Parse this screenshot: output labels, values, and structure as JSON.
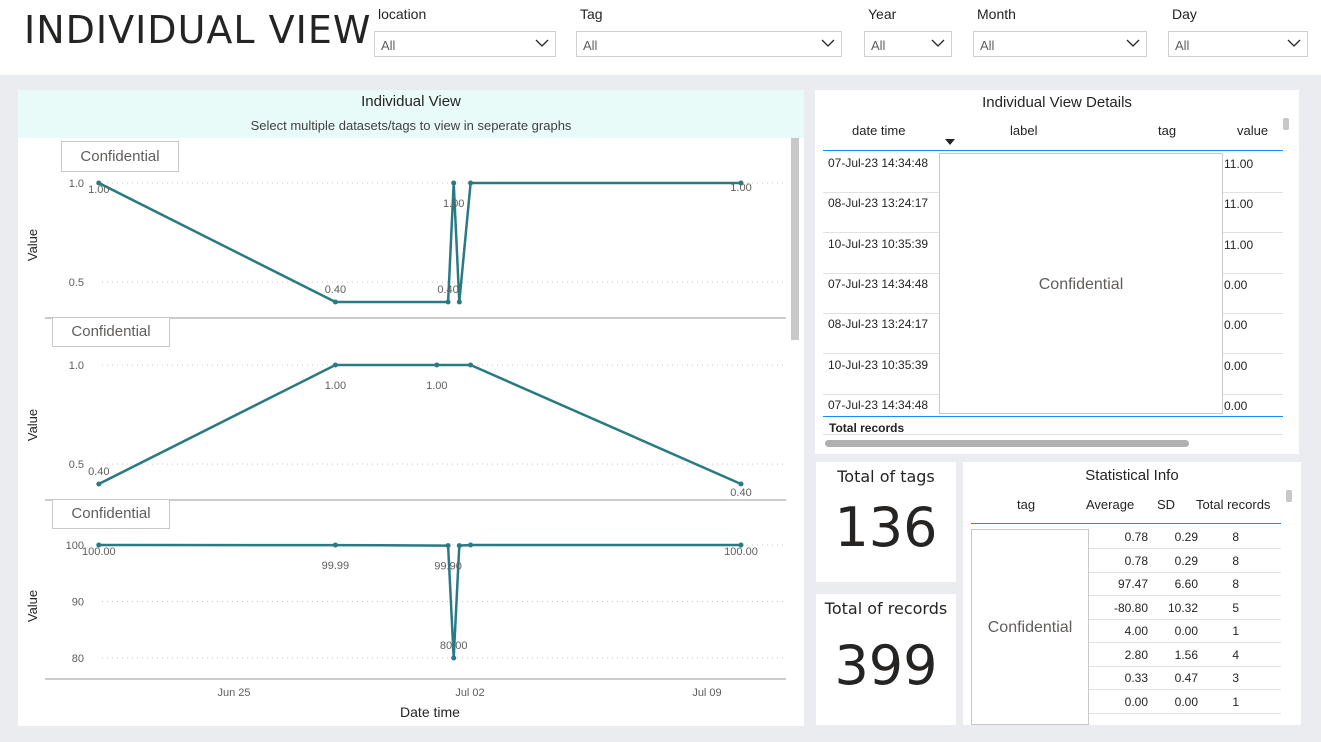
{
  "page_title": "INDIVIDUAL VIEW",
  "filters": [
    {
      "label": "location",
      "value": "All"
    },
    {
      "label": "Tag",
      "value": "All"
    },
    {
      "label": "Year",
      "value": "All"
    },
    {
      "label": "Month",
      "value": "All"
    },
    {
      "label": "Day",
      "value": "All"
    }
  ],
  "individual_view": {
    "title": "Individual View",
    "subtitle": "Select multiple datasets/tags to view in seperate graphs",
    "y_axis_label": "Value",
    "x_axis_label": "Date time",
    "x_ticks": [
      "Jun 25",
      "Jul 02",
      "Jul 09"
    ]
  },
  "chart_data": [
    {
      "type": "line",
      "title": "Confidential",
      "ylabel": "Value",
      "xlabel": "Date time",
      "y_ticks": [
        "1.0",
        "0.5"
      ],
      "ylim": [
        0.4,
        1.0
      ],
      "x_ticks": [
        "Jun 25",
        "Jul 02",
        "Jul 09"
      ],
      "series": [
        {
          "x": [
            "2023-06-21",
            "2023-06-28",
            "2023-07-01 08:00",
            "2023-07-01 12:00",
            "2023-07-01 16:00",
            "2023-07-02",
            "2023-07-10"
          ],
          "values": [
            1.0,
            0.4,
            0.4,
            1.0,
            0.4,
            1.0,
            1.0
          ]
        }
      ],
      "data_labels": [
        "1.00",
        "0.40",
        "0.40",
        "1.00",
        "1.00"
      ]
    },
    {
      "type": "line",
      "title": "Confidential",
      "ylabel": "Value",
      "y_ticks": [
        "1.0",
        "0.5"
      ],
      "ylim": [
        0.4,
        1.0
      ],
      "series": [
        {
          "x": [
            "2023-06-21",
            "2023-06-28",
            "2023-07-01",
            "2023-07-02",
            "2023-07-10"
          ],
          "values": [
            0.4,
            1.0,
            1.0,
            1.0,
            0.4
          ]
        }
      ],
      "data_labels": [
        "0.40",
        "1.00",
        "1.00",
        "0.40"
      ]
    },
    {
      "type": "line",
      "title": "Confidential",
      "ylabel": "Value",
      "y_ticks": [
        "100",
        "90",
        "80"
      ],
      "ylim": [
        80,
        100
      ],
      "series": [
        {
          "x": [
            "2023-06-21",
            "2023-06-28",
            "2023-07-01 08:00",
            "2023-07-01 12:00",
            "2023-07-01 16:00",
            "2023-07-02",
            "2023-07-10"
          ],
          "values": [
            100.0,
            99.99,
            99.9,
            80.0,
            99.9,
            100.0,
            100.0
          ]
        }
      ],
      "data_labels": [
        "100.00",
        "99.99",
        "99.90",
        "80.00",
        "100.00"
      ]
    }
  ],
  "details": {
    "title": "Individual View Details",
    "columns": [
      "date time",
      "label",
      "tag",
      "value"
    ],
    "rows": [
      {
        "date": "07-Jul-23 14:34:48",
        "value": "11.00"
      },
      {
        "date": "08-Jul-23 13:24:17",
        "value": "11.00"
      },
      {
        "date": "10-Jul-23 10:35:39",
        "value": "11.00"
      },
      {
        "date": "07-Jul-23 14:34:48",
        "value": "0.00"
      },
      {
        "date": "08-Jul-23 13:24:17",
        "value": "0.00"
      },
      {
        "date": "10-Jul-23 10:35:39",
        "value": "0.00"
      },
      {
        "date": "07-Jul-23 14:34:48",
        "value": "0.00"
      }
    ],
    "confidential": "Confidential",
    "total_label": "Total records"
  },
  "kpis": {
    "tags_label": "Total of tags",
    "tags_value": "136",
    "records_label": "Total of records",
    "records_value": "399"
  },
  "stats": {
    "title": "Statistical Info",
    "columns": [
      "tag",
      "Average",
      "SD",
      "Total records"
    ],
    "confidential": "Confidential",
    "rows": [
      {
        "avg": "0.78",
        "sd": "0.29",
        "total": "8"
      },
      {
        "avg": "0.78",
        "sd": "0.29",
        "total": "8"
      },
      {
        "avg": "97.47",
        "sd": "6.60",
        "total": "8"
      },
      {
        "avg": "-80.80",
        "sd": "10.32",
        "total": "5"
      },
      {
        "avg": "4.00",
        "sd": "0.00",
        "total": "1"
      },
      {
        "avg": "2.80",
        "sd": "1.56",
        "total": "4"
      },
      {
        "avg": "0.33",
        "sd": "0.47",
        "total": "3"
      },
      {
        "avg": "0.00",
        "sd": "0.00",
        "total": "1"
      }
    ]
  },
  "colors": {
    "line": "#2a7a84",
    "accent": "#118dff",
    "header_bg": "#e8fbf9"
  }
}
